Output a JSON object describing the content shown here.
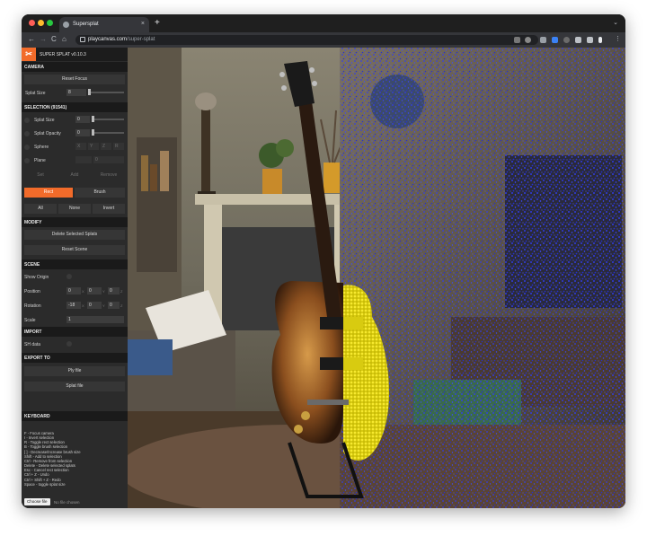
{
  "browser": {
    "tab_title": "Supersplat",
    "tab_close": "×",
    "new_tab": "+",
    "tab_menu": "⌄",
    "nav_back": "←",
    "nav_forward": "→",
    "nav_reload": "C",
    "nav_home": "⌂",
    "url_host": "playcanvas.com",
    "url_path": "/super-splat",
    "more": "⋮"
  },
  "app": {
    "title": "SUPER SPLAT v0.10.3",
    "logo": "✂"
  },
  "camera": {
    "header": "CAMERA",
    "reset_focus": "Reset Focus",
    "splat_size_label": "Splat Size",
    "splat_size_value": "8",
    "splat_size_level": 0.05
  },
  "selection": {
    "header": "SELECTION (91541)",
    "splat_size_label": "Splat Size",
    "splat_size_value": "0",
    "splat_opacity_label": "Splat Opacity",
    "splat_opacity_value": "0",
    "sphere_label": "Sphere",
    "sphere_values": [
      "X",
      "Y",
      "Z",
      "R"
    ],
    "plane_label": "Plane",
    "plane_value": "0",
    "set_label": "Set",
    "add_label": "Add",
    "remove_label": "Remove",
    "rect_label": "Rect",
    "brush_label": "Brush",
    "all_label": "All",
    "none_label": "None",
    "invert_label": "Invert"
  },
  "modify": {
    "header": "MODIFY",
    "delete_label": "Delete Selected Splats",
    "reset_label": "Reset Scene"
  },
  "scene": {
    "header": "SCENE",
    "show_origin_label": "Show Origin",
    "position_label": "Position",
    "position_values": [
      "0",
      "0",
      "0"
    ],
    "rotation_label": "Rotation",
    "rotation_values": [
      "-18",
      "0",
      "0"
    ],
    "scale_label": "Scale",
    "scale_value": "1",
    "axis_letters": [
      "X",
      "Y",
      "Z"
    ]
  },
  "import": {
    "header": "IMPORT",
    "sh_data_label": "SH data"
  },
  "export": {
    "header": "EXPORT TO",
    "ply_label": "Ply file",
    "splat_label": "Splat file"
  },
  "keyboard": {
    "header": "KEYBOARD",
    "lines": [
      "F - Focus camera",
      "I - Invert selection",
      "R - Toggle rect selection",
      "B - Toggle brush selection",
      "[ ] - Decrease/Increase brush size",
      "Shift - Add to selection",
      "Ctrl - Remove from selection",
      "Delete - Delete selected splats",
      "Esc - Cancel rect selection",
      "Ctrl + Z - Undo",
      "Ctrl + Shift + Z - Redo",
      "Space - toggle splat size"
    ]
  },
  "file": {
    "button_label": "Choose file",
    "status": "No file chosen"
  },
  "colors": {
    "accent": "#f26b2a",
    "panel_bg": "#2b2b2b",
    "section_bg": "#1a1a1a",
    "selection_yellow": "#f5e71a",
    "splat_blue": "#2f3cf0"
  },
  "icons": {
    "logo": "scissors-logo-icon",
    "lock": "lock-icon",
    "extensions": "puzzle-icon"
  }
}
